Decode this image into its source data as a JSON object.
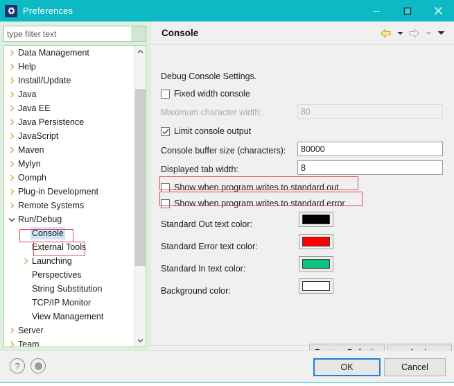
{
  "window": {
    "title": "Preferences",
    "icon": "gear-icon",
    "titlebar_color": "#0cb9c4",
    "controls": {
      "minimize": "minimize-icon",
      "maximize": "maximize-icon",
      "close": "close-icon"
    }
  },
  "sidebar": {
    "filter": {
      "placeholder": "type filter text",
      "value": ""
    },
    "items": [
      {
        "label": "Data Management",
        "indent": 0,
        "twisty": "collapsed",
        "selected": false
      },
      {
        "label": "Help",
        "indent": 0,
        "twisty": "collapsed",
        "selected": false
      },
      {
        "label": "Install/Update",
        "indent": 0,
        "twisty": "collapsed",
        "selected": false
      },
      {
        "label": "Java",
        "indent": 0,
        "twisty": "collapsed",
        "selected": false
      },
      {
        "label": "Java EE",
        "indent": 0,
        "twisty": "collapsed",
        "selected": false
      },
      {
        "label": "Java Persistence",
        "indent": 0,
        "twisty": "collapsed",
        "selected": false
      },
      {
        "label": "JavaScript",
        "indent": 0,
        "twisty": "collapsed",
        "selected": false
      },
      {
        "label": "Maven",
        "indent": 0,
        "twisty": "collapsed",
        "selected": false
      },
      {
        "label": "Mylyn",
        "indent": 0,
        "twisty": "collapsed",
        "selected": false
      },
      {
        "label": "Oomph",
        "indent": 0,
        "twisty": "collapsed",
        "selected": false
      },
      {
        "label": "Plug-in Development",
        "indent": 0,
        "twisty": "collapsed",
        "selected": false
      },
      {
        "label": "Remote Systems",
        "indent": 0,
        "twisty": "collapsed",
        "selected": false
      },
      {
        "label": "Run/Debug",
        "indent": 0,
        "twisty": "expanded",
        "selected": false
      },
      {
        "label": "Console",
        "indent": 1,
        "twisty": "none",
        "selected": true
      },
      {
        "label": "External Tools",
        "indent": 1,
        "twisty": "none",
        "selected": false
      },
      {
        "label": "Launching",
        "indent": 1,
        "twisty": "collapsed",
        "selected": false
      },
      {
        "label": "Perspectives",
        "indent": 1,
        "twisty": "none",
        "selected": false
      },
      {
        "label": "String Substitution",
        "indent": 1,
        "twisty": "none",
        "selected": false
      },
      {
        "label": "TCP/IP Monitor",
        "indent": 1,
        "twisty": "none",
        "selected": false
      },
      {
        "label": "View Management",
        "indent": 1,
        "twisty": "none",
        "selected": false
      },
      {
        "label": "Server",
        "indent": 0,
        "twisty": "collapsed",
        "selected": false
      },
      {
        "label": "Team",
        "indent": 0,
        "twisty": "collapsed",
        "selected": false
      }
    ]
  },
  "page": {
    "title": "Console",
    "nav": {
      "back": "back-arrow-icon",
      "back_menu": "chevron-down-icon",
      "forward": "forward-arrow-icon",
      "forward_menu": "chevron-down-icon",
      "menu": "chevron-down-icon"
    },
    "description": "Debug Console Settings.",
    "checkboxes": [
      {
        "label": "Fixed width console",
        "checked": false,
        "annotated": false
      },
      {
        "label": "Limit console output",
        "checked": true,
        "annotated": false
      },
      {
        "label": "Show when program writes to standard out",
        "checked": false,
        "annotated": true
      },
      {
        "label": "Show when program writes to standard error",
        "checked": false,
        "annotated": true
      }
    ],
    "fields": [
      {
        "label": "Maximum character width:",
        "value": "80",
        "disabled": true
      },
      {
        "label": "Console buffer size (characters):",
        "value": "80000",
        "disabled": false
      },
      {
        "label": "Displayed tab width:",
        "value": "8",
        "disabled": false
      }
    ],
    "colors": [
      {
        "label": "Standard Out text color:",
        "color": "#000000"
      },
      {
        "label": "Standard Error text color:",
        "color": "#ff0000"
      },
      {
        "label": "Standard In text color:",
        "color": "#0ec17f"
      },
      {
        "label": "Background color:",
        "color": "#ffffff"
      }
    ],
    "restore_defaults_label": "Restore Defaults",
    "apply_label": "Apply"
  },
  "footer": {
    "help_icon": "question-mark-icon",
    "progress_icon": "progress-indicator-icon",
    "ok_label": "OK",
    "cancel_label": "Cancel"
  }
}
